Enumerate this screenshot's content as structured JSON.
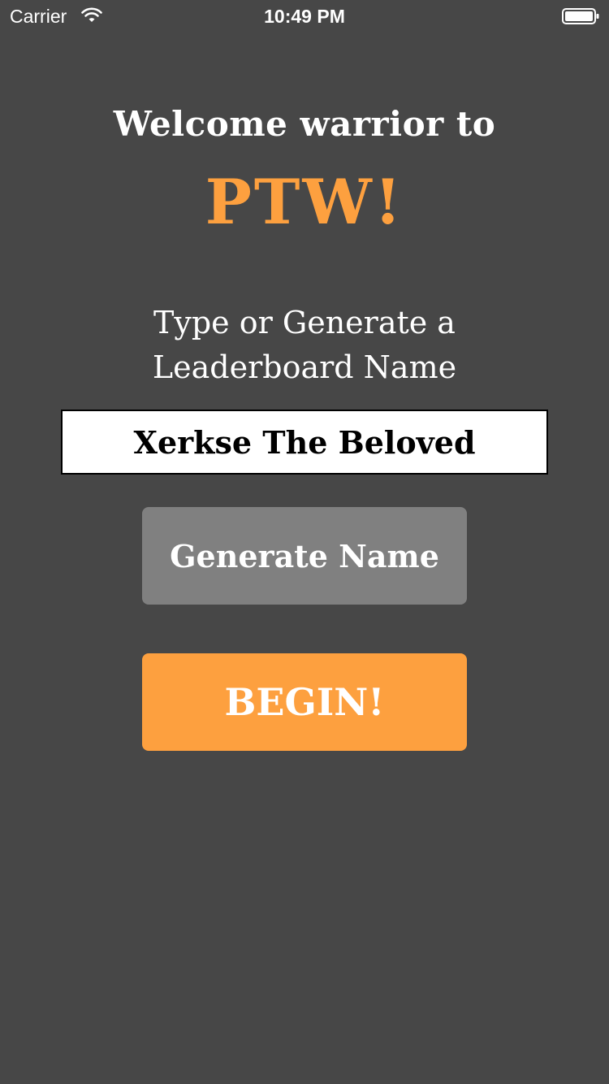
{
  "status_bar": {
    "carrier": "Carrier",
    "time": "10:49 PM"
  },
  "header": {
    "welcome_text": "Welcome warrior to",
    "app_name": "PTW!"
  },
  "prompt": {
    "line1": "Type or Generate a",
    "line2": "Leaderboard Name"
  },
  "name_field": {
    "value": "Xerkse The Beloved"
  },
  "buttons": {
    "generate_label": "Generate Name",
    "begin_label": "BEGIN!"
  },
  "colors": {
    "background": "#474747",
    "accent": "#fda03f",
    "secondary_button": "#808080"
  }
}
